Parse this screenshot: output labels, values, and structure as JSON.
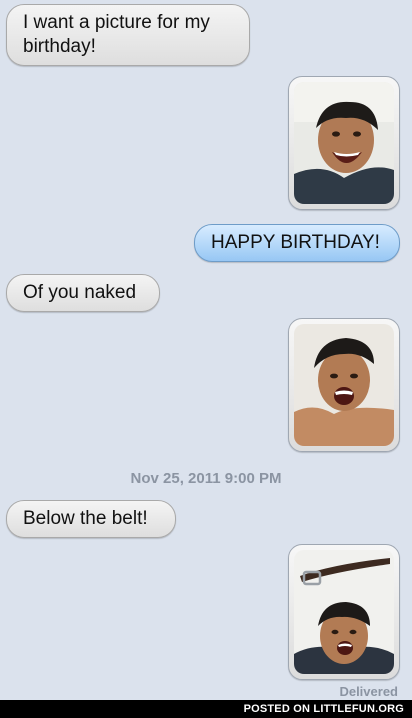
{
  "messages": [
    {
      "type": "received",
      "text": "I want a picture for my birthday!"
    },
    {
      "type": "sent-photo",
      "image": "photo-smiling-face"
    },
    {
      "type": "sent",
      "text": "HAPPY BIRTHDAY!"
    },
    {
      "type": "received",
      "text": "Of you naked"
    },
    {
      "type": "sent-photo",
      "image": "photo-shirtless-selfie"
    },
    {
      "type": "received",
      "text": "Below the belt!"
    },
    {
      "type": "sent-photo",
      "image": "photo-belt-above-head"
    }
  ],
  "timestamp": "Nov 25, 2011 9:00 PM",
  "status": "Delivered",
  "footer": "POSTED ON LITTLEFUN.ORG",
  "colors": {
    "background": "#dbe2ed",
    "received_bubble": "#e8e8e8",
    "sent_bubble": "#b3d8fb",
    "meta_text": "#8b94a2"
  }
}
